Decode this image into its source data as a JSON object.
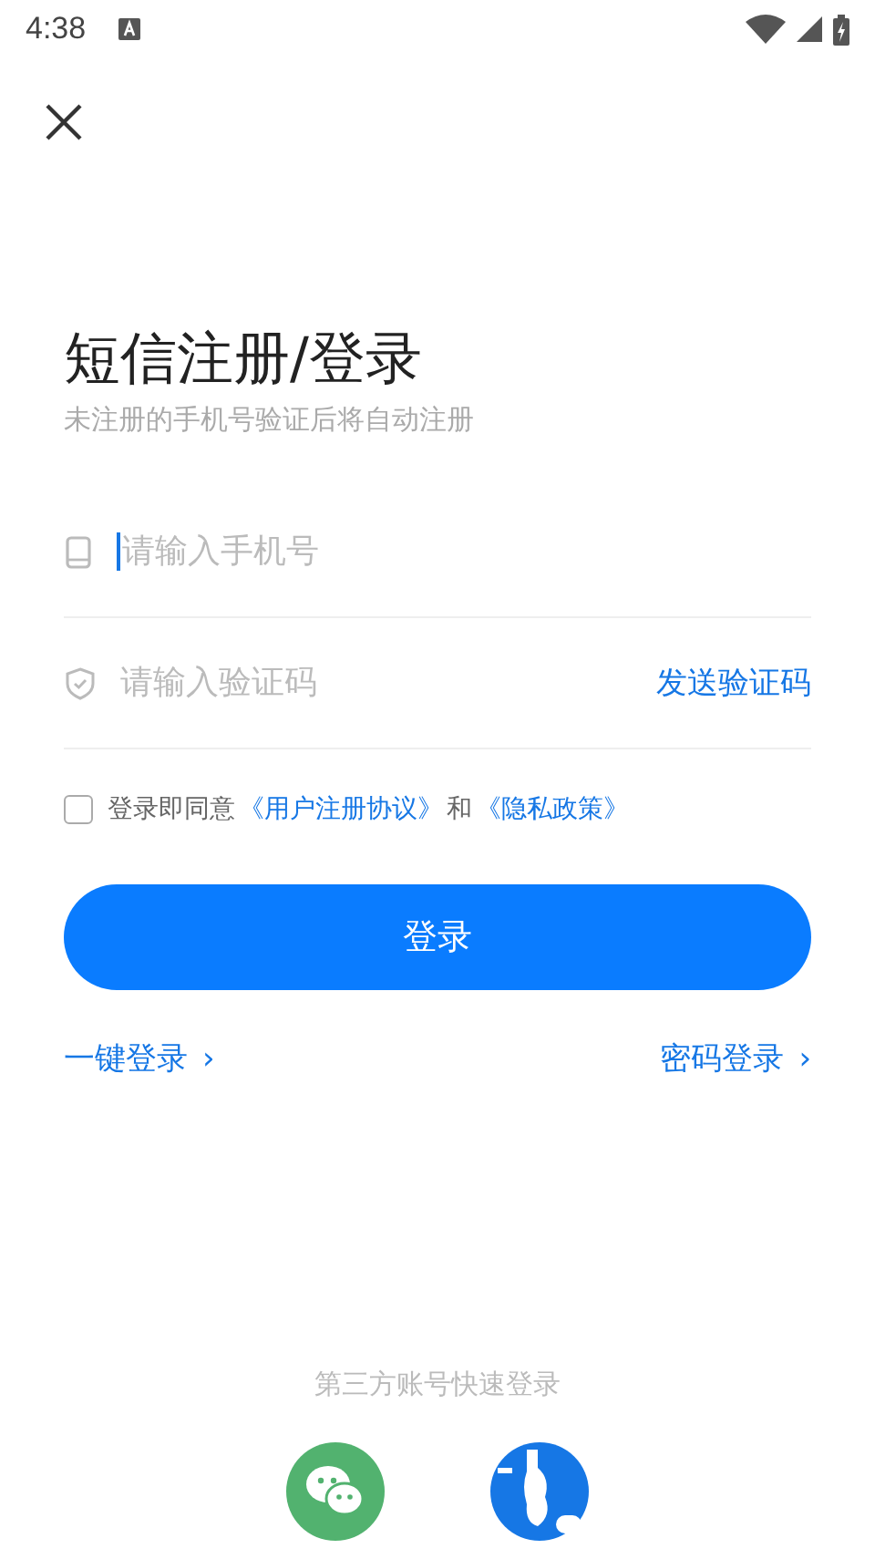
{
  "status_bar": {
    "time": "4:38"
  },
  "title": "短信注册/登录",
  "subtitle": "未注册的手机号验证后将自动注册",
  "phone_field": {
    "placeholder": "请输入手机号"
  },
  "code_field": {
    "placeholder": "请输入验证码"
  },
  "send_code": "发送验证码",
  "agreement": {
    "checked": false,
    "text": "登录即同意",
    "link_1": "《用户注册协议》",
    "joiner": "和",
    "link_2": "《隐私政策》"
  },
  "login_button": "登录",
  "links": [
    {
      "label": "一键登录",
      "chevron": "›"
    },
    {
      "label": "密码登录",
      "chevron": "›"
    }
  ],
  "third_party": {
    "title": "第三方账号快速登录",
    "providers": [
      {
        "kind": "chat"
      },
      {
        "kind": "blue"
      }
    ]
  }
}
